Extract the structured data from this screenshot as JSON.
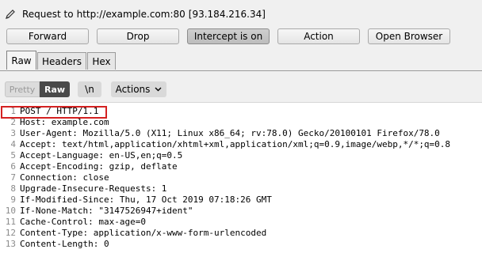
{
  "request": {
    "label": "Request to",
    "url": "http://example.com:80",
    "address": "[93.184.216.34]"
  },
  "buttons": {
    "forward": "Forward",
    "drop": "Drop",
    "intercept": "Intercept is on",
    "action": "Action",
    "open_browser": "Open Browser"
  },
  "tabs": [
    "Raw",
    "Headers",
    "Hex"
  ],
  "toolbar": {
    "pretty": "Pretty",
    "raw": "Raw",
    "newline": "\\n",
    "actions": "Actions"
  },
  "lines": [
    {
      "n": "1",
      "text": "POST / HTTP/1.1"
    },
    {
      "n": "2",
      "text": "Host: example.com"
    },
    {
      "n": "3",
      "text": "User-Agent: Mozilla/5.0 (X11; Linux x86_64; rv:78.0) Gecko/20100101 Firefox/78.0"
    },
    {
      "n": "4",
      "text": "Accept: text/html,application/xhtml+xml,application/xml;q=0.9,image/webp,*/*;q=0.8"
    },
    {
      "n": "5",
      "text": "Accept-Language: en-US,en;q=0.5"
    },
    {
      "n": "6",
      "text": "Accept-Encoding: gzip, deflate"
    },
    {
      "n": "7",
      "text": "Connection: close"
    },
    {
      "n": "8",
      "text": "Upgrade-Insecure-Requests: 1"
    },
    {
      "n": "9",
      "text": "If-Modified-Since: Thu, 17 Oct 2019 07:18:26 GMT"
    },
    {
      "n": "10",
      "text": "If-None-Match: \"3147526947+ident\""
    },
    {
      "n": "11",
      "text": "Cache-Control: max-age=0"
    },
    {
      "n": "12",
      "text": "Content-Type: application/x-www-form-urlencoded"
    },
    {
      "n": "13",
      "text": "Content-Length: 0"
    }
  ],
  "colors": {
    "highlight": "#d42121",
    "raw_active": "#4a4a4a",
    "intercept_on": "#c6c6c6"
  },
  "icons": {
    "request": "pencil-icon",
    "actions": "chevron-down-icon"
  }
}
